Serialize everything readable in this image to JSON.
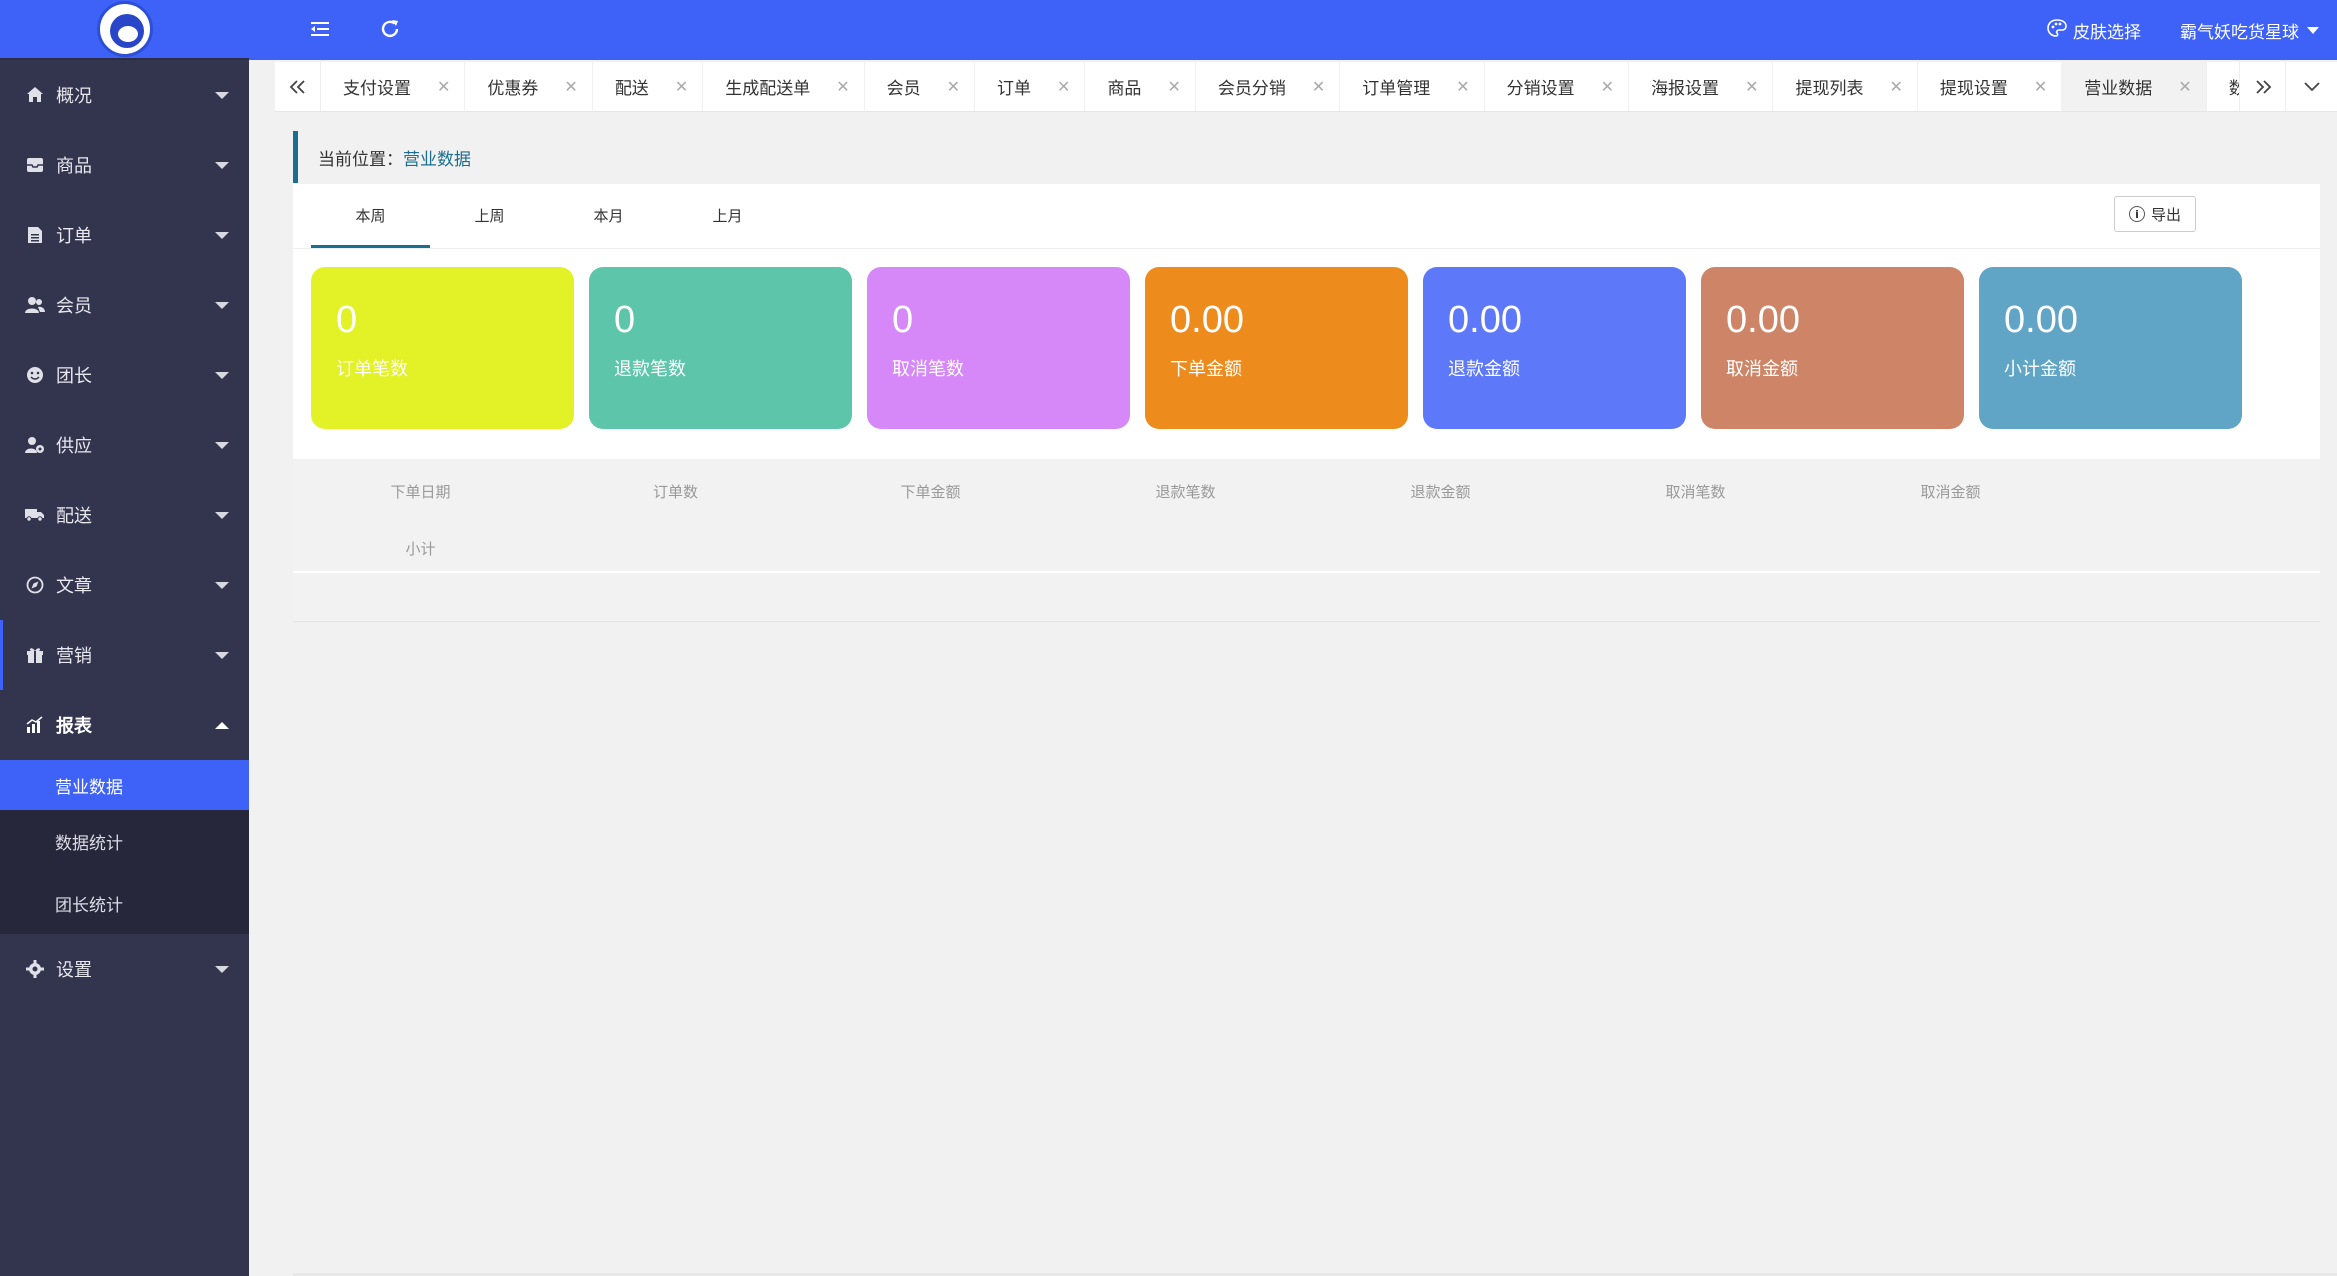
{
  "topbar": {
    "skin_label": "皮肤选择",
    "user_name": "霸气妖吃货星球"
  },
  "sidebar": {
    "items": [
      {
        "label": "概况",
        "icon": "home-icon"
      },
      {
        "label": "商品",
        "icon": "inbox-icon"
      },
      {
        "label": "订单",
        "icon": "file-icon"
      },
      {
        "label": "会员",
        "icon": "users-icon"
      },
      {
        "label": "团长",
        "icon": "smile-icon"
      },
      {
        "label": "供应",
        "icon": "user-gear-icon"
      },
      {
        "label": "配送",
        "icon": "truck-icon"
      },
      {
        "label": "文章",
        "icon": "compass-icon"
      },
      {
        "label": "营销",
        "icon": "gift-icon"
      },
      {
        "label": "报表",
        "icon": "chart-icon"
      }
    ],
    "report_sub": [
      "营业数据",
      "数据统计",
      "团长统计"
    ],
    "settings": {
      "label": "设置",
      "icon": "gear-icon"
    }
  },
  "tabs": [
    {
      "label": "支付设置"
    },
    {
      "label": "优惠券"
    },
    {
      "label": "配送"
    },
    {
      "label": "生成配送单"
    },
    {
      "label": "会员"
    },
    {
      "label": "订单"
    },
    {
      "label": "商品"
    },
    {
      "label": "会员分销"
    },
    {
      "label": "订单管理"
    },
    {
      "label": "分销设置"
    },
    {
      "label": "海报设置"
    },
    {
      "label": "提现列表"
    },
    {
      "label": "提现设置"
    },
    {
      "label": "营业数据",
      "active": true
    },
    {
      "label": "数据统计"
    }
  ],
  "breadcrumb": {
    "prefix": "当前位置：",
    "current": "营业数据"
  },
  "period_tabs": [
    "本周",
    "上周",
    "本月",
    "上月"
  ],
  "export_label": "导出",
  "cards": [
    {
      "value": "0",
      "label": "订单笔数",
      "color": "#e2f226"
    },
    {
      "value": "0",
      "label": "退款笔数",
      "color": "#5dc5aa"
    },
    {
      "value": "0",
      "label": "取消笔数",
      "color": "#d687f8"
    },
    {
      "value": "0.00",
      "label": "下单金额",
      "color": "#ed8b1d"
    },
    {
      "value": "0.00",
      "label": "退款金额",
      "color": "#5d78f8"
    },
    {
      "value": "0.00",
      "label": "取消金额",
      "color": "#ce8467"
    },
    {
      "value": "0.00",
      "label": "小计金额",
      "color": "#60a4c6"
    }
  ],
  "table_headers": [
    "下单日期",
    "订单数",
    "下单金额",
    "退款笔数",
    "退款金额",
    "取消笔数",
    "取消金额",
    "小计"
  ]
}
